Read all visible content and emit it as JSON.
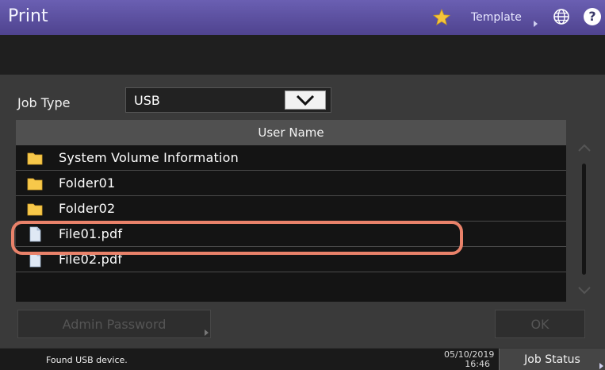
{
  "header": {
    "title": "Print",
    "template_label": "Template",
    "help_label": "?"
  },
  "job_type": {
    "label": "Job Type",
    "value": "USB"
  },
  "list": {
    "column_header": "User Name",
    "items": [
      {
        "label": "System Volume Information",
        "type": "folder-icon"
      },
      {
        "label": "Folder01",
        "type": "folder-icon"
      },
      {
        "label": "Folder02",
        "type": "folder-icon"
      },
      {
        "label": "File01.pdf",
        "type": "file-icon"
      },
      {
        "label": "File02.pdf",
        "type": "file-icon"
      }
    ]
  },
  "buttons": {
    "admin_password": "Admin Password",
    "ok": "OK"
  },
  "status": {
    "message": "Found USB device.",
    "date": "05/10/2019",
    "time": "16:46",
    "job_status": "Job Status"
  },
  "colors": {
    "title_bar": "#5a4fa0",
    "highlight": "#e9826a",
    "folder": "#f7c84a"
  }
}
